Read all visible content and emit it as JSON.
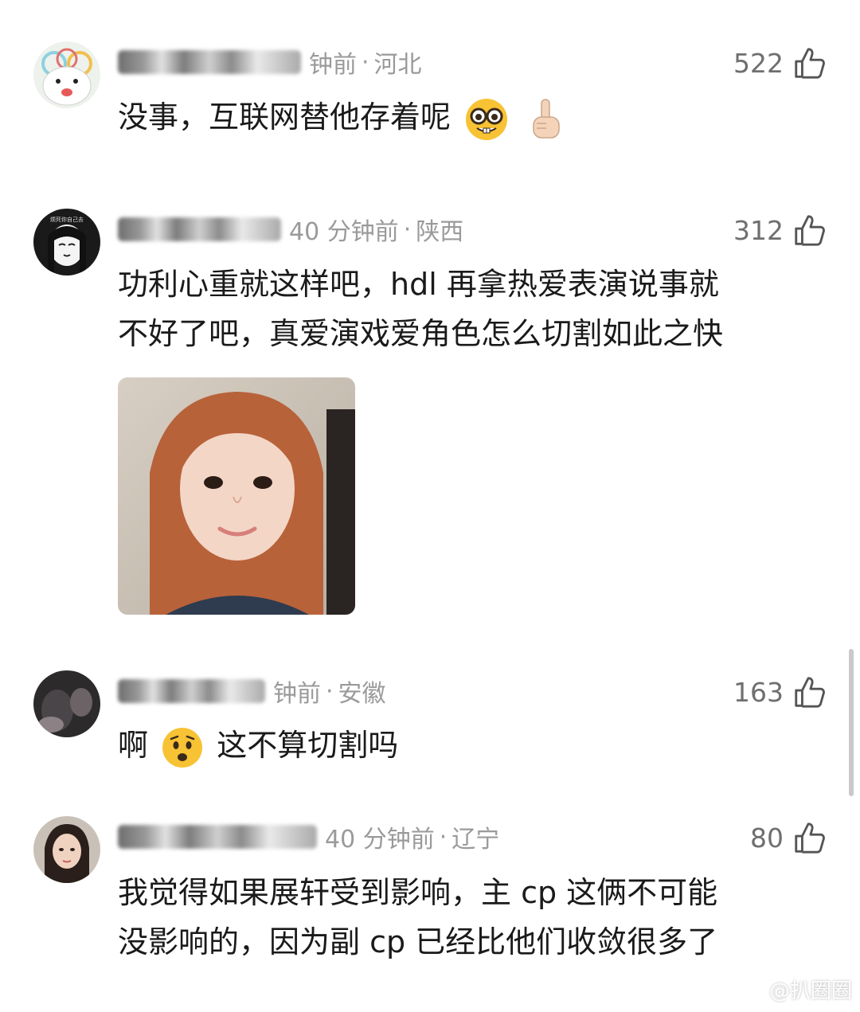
{
  "comments": [
    {
      "username": "",
      "time_fragment": "钟前",
      "separator": "·",
      "location": "河北",
      "likes": "522",
      "text": "没事，互联网替他存着呢"
    },
    {
      "username": "",
      "time_fragment": "40 分钟前",
      "separator": "·",
      "location": "陕西",
      "likes": "312",
      "text_line1": "功利心重就这样吧，hdl 再拿热爱表演说事就",
      "text_line2": "不好了吧，真爱演戏爱角色怎么切割如此之快"
    },
    {
      "username": "",
      "time_fragment": "钟前",
      "separator": "·",
      "location": "安徽",
      "likes": "163",
      "text_before": "啊",
      "text_after": "这不算切割吗"
    },
    {
      "username": "",
      "time_fragment": "40 分钟前",
      "separator": "·",
      "location": "辽宁",
      "likes": "80",
      "text_line1": "我觉得如果展轩受到影响，主 cp 这俩不可能",
      "text_line2": "没影响的，因为副 cp 已经比他们收敛很多了"
    }
  ],
  "watermark": {
    "text": "@扒圈圈"
  },
  "colors": {
    "meta_gray": "#9a9a9a",
    "likes_gray": "#6f6f6f",
    "text": "#1a1a1a",
    "emoji_yellow": "#f7c234"
  },
  "icons": [
    "thumbs-up-icon",
    "nerd-face-emoji",
    "pointing-up-emoji",
    "worried-face-emoji",
    "weibo-icon"
  ]
}
